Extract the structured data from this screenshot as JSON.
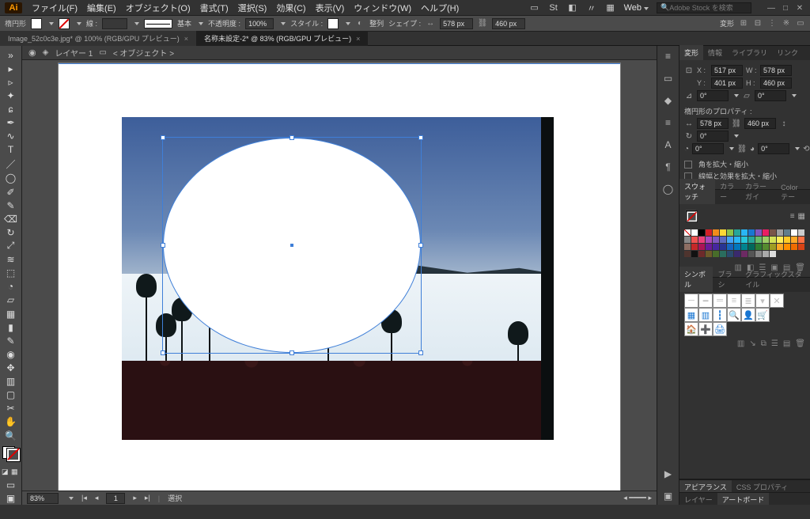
{
  "app": {
    "logo": "Ai"
  },
  "menu": {
    "file": "ファイル(F)",
    "edit": "編集(E)",
    "object": "オブジェクト(O)",
    "type": "書式(T)",
    "select": "選択(S)",
    "effect": "効果(C)",
    "view": "表示(V)",
    "window": "ウィンドウ(W)",
    "help": "ヘルプ(H)"
  },
  "top": {
    "workspace": "Web",
    "search_placeholder": "Adobe Stock を検索"
  },
  "control": {
    "shape_label": "楕円形",
    "stroke_label": "線 :",
    "stroke_weight": "",
    "stroke_style_label": "基本",
    "opacity_label": "不透明度 :",
    "opacity": "100%",
    "style_label": "スタイル :",
    "align_label": "整列",
    "shape_btn_label": "シェイプ :",
    "width": "578 px",
    "height": "460 px",
    "transform_label": "変形"
  },
  "tabs": {
    "t1": "Image_52c0c3e.jpg* @ 100% (RGB/GPU プレビュー)",
    "t2": "名称未設定-2* @ 83% (RGB/GPU プレビュー)"
  },
  "layerbar": {
    "layer": "レイヤー 1",
    "obj": "< オブジェクト >"
  },
  "status": {
    "zoom": "83%",
    "artboard": "1",
    "tool": "選択"
  },
  "panels": {
    "transform": {
      "tabs": {
        "trans": "変形",
        "info": "情報",
        "lib": "ライブラリ",
        "link": "リンク"
      },
      "x": "517 px",
      "y": "401 px",
      "w": "578 px",
      "h": "460 px",
      "angle": "0°",
      "shear": "0°",
      "prop_title": "楕円形のプロパティ :",
      "pw": "578 px",
      "ph": "460 px",
      "pie_start": "0°",
      "pie_end": "0°",
      "chk1": "角を拡大・縮小",
      "chk2": "線幅と効果を拡大・縮小"
    },
    "swatch": {
      "tabs": {
        "sw": "スウォッチ",
        "color": "カラー",
        "guide": "カラーガイ",
        "theme": "Color テー"
      }
    },
    "symbol": {
      "tabs": {
        "sym": "シンボル",
        "brush": "ブラシ",
        "gstyle": "グラフィックスタイル"
      }
    },
    "appearance": {
      "tabs": {
        "ap": "アピアランス",
        "css": "CSS プロパティ"
      }
    },
    "layers": {
      "tabs": {
        "ly": "レイヤー",
        "ab": "アートボード"
      }
    }
  },
  "colors": {
    "row1": [
      "#ffffff",
      "#000000",
      "#d22027",
      "#f28c1b",
      "#fdd835",
      "#8bc34a",
      "#26a69a",
      "#29b6f6",
      "#1976d2",
      "#7e57c2",
      "#e91e63",
      "#795548",
      "#9e9e9e",
      "#607d8b",
      "#ffffff",
      "#cccccc",
      "#888888"
    ],
    "row2": [
      "#ef5350",
      "#ec407a",
      "#ab47bc",
      "#7e57c2",
      "#5c6bc0",
      "#42a5f5",
      "#29b6f6",
      "#26c6da",
      "#26a69a",
      "#66bb6a",
      "#9ccc65",
      "#d4e157",
      "#ffee58",
      "#ffca28",
      "#ffa726",
      "#ff7043",
      "#8d6e63"
    ],
    "row3": [
      "#c62828",
      "#ad1457",
      "#6a1b9a",
      "#4527a0",
      "#283593",
      "#1565c0",
      "#0277bd",
      "#00838f",
      "#00695c",
      "#2e7d32",
      "#558b2f",
      "#9e9d24",
      "#f9a825",
      "#ff8f00",
      "#ef6c00",
      "#d84315",
      "#4e342e"
    ],
    "row4": [
      "#111111",
      "#6d2a2a",
      "#6d5a2a",
      "#486d2a",
      "#2a6d5e",
      "#2a4a6d",
      "#3a2a6d",
      "#6d2a63",
      "#555555",
      "#888888",
      "#aaaaaa",
      "#dddddd"
    ]
  }
}
